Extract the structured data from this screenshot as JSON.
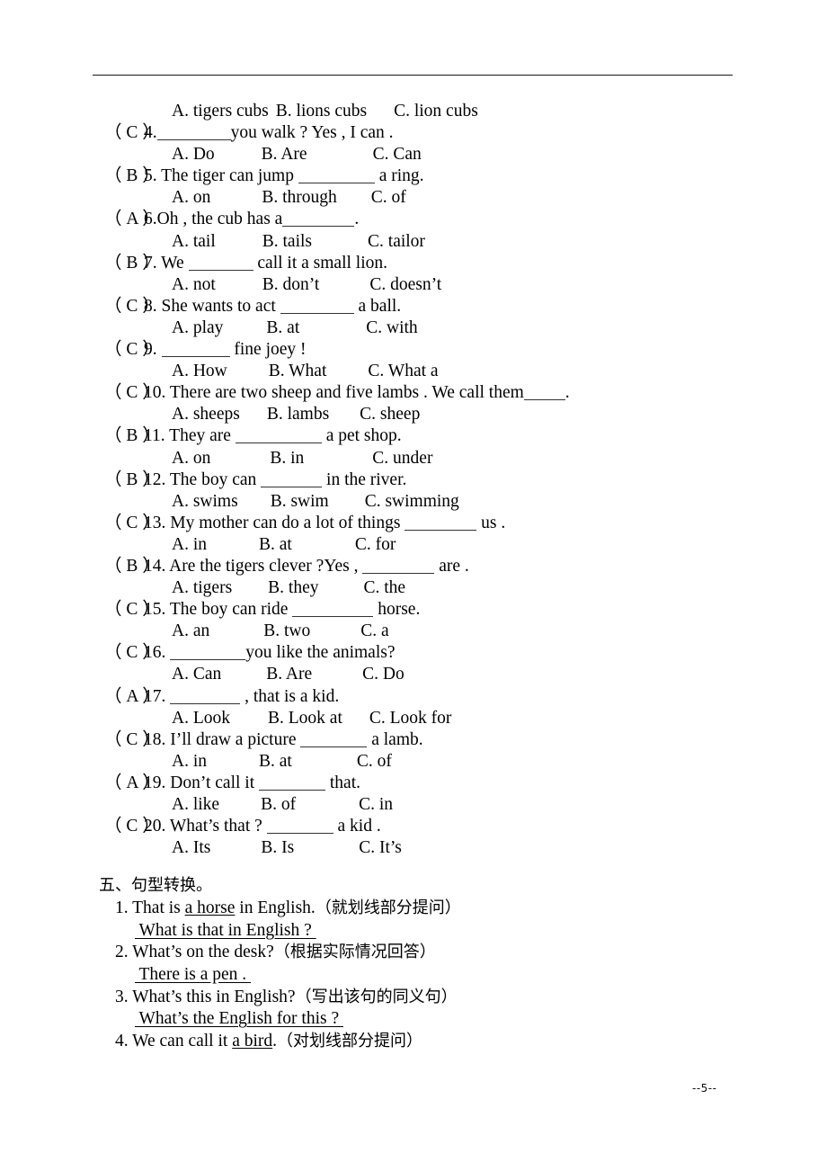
{
  "page": {
    "footer_label": "--5--",
    "header_rule": true
  },
  "orphan_options": {
    "a": "A. tigers cubs",
    "b": "B. lions cubs",
    "c": "C. lion cubs"
  },
  "multiple_choice": {
    "questions": [
      {
        "answer": "C",
        "number": "4.",
        "text_before": "",
        "blank_width": 82,
        "text_after": "you walk ? Yes , I can .",
        "options": [
          {
            "label": "A. Do",
            "gap": 52
          },
          {
            "label": "B. Are",
            "gap": 73
          },
          {
            "label": "C. Can",
            "gap": 0
          }
        ]
      },
      {
        "answer": "B",
        "number": "5.",
        "text_before": " The tiger can jump ",
        "blank_width": 85,
        "text_after": " a ring.",
        "options": [
          {
            "label": "A. on",
            "gap": 57
          },
          {
            "label": "B. through",
            "gap": 38
          },
          {
            "label": "C. of",
            "gap": 0
          }
        ]
      },
      {
        "answer": "A",
        "number": "6.",
        "text_before": "Oh , the cub has a",
        "blank_width": 80,
        "text_after": ".",
        "options": [
          {
            "label": "A. tail",
            "gap": 52
          },
          {
            "label": "B. tails",
            "gap": 62
          },
          {
            "label": "C. tailor",
            "gap": 0
          }
        ]
      },
      {
        "answer": "B",
        "number": "7.",
        "text_before": " We ",
        "blank_width": 72,
        "text_after": " call it a small lion.",
        "options": [
          {
            "label": "A. not",
            "gap": 52
          },
          {
            "label": "B. don’t",
            "gap": 56
          },
          {
            "label": "C. doesn’t",
            "gap": 0
          }
        ]
      },
      {
        "answer": "C",
        "number": "8.",
        "text_before": " She wants to act ",
        "blank_width": 82,
        "text_after": " a ball.",
        "options": [
          {
            "label": "A. play",
            "gap": 48
          },
          {
            "label": "B. at",
            "gap": 74
          },
          {
            "label": "C. with",
            "gap": 0
          }
        ]
      },
      {
        "answer": "C",
        "number": "9.",
        "text_before": " ",
        "blank_width": 76,
        "text_after": " fine joey !",
        "options": [
          {
            "label": "A. How",
            "gap": 46
          },
          {
            "label": "B. What",
            "gap": 46
          },
          {
            "label": "C. What a",
            "gap": 0
          }
        ]
      },
      {
        "answer": "C",
        "number": "10.",
        "text_before": " There are two sheep and five lambs . We call them",
        "blank_width": 46,
        "text_after": ".",
        "options": [
          {
            "label": "A. sheeps",
            "gap": 30
          },
          {
            "label": "B. lambs",
            "gap": 34
          },
          {
            "label": "C. sheep",
            "gap": 0
          }
        ]
      },
      {
        "answer": "B",
        "number": "11.",
        "text_before": " They are ",
        "blank_width": 96,
        "text_after": " a pet shop.",
        "options": [
          {
            "label": "A. on",
            "gap": 66
          },
          {
            "label": "B. in",
            "gap": 76
          },
          {
            "label": "C. under",
            "gap": 0
          }
        ]
      },
      {
        "answer": "B",
        "number": "12.",
        "text_before": " The boy can ",
        "blank_width": 68,
        "text_after": " in the river.",
        "options": [
          {
            "label": "A. swims",
            "gap": 36
          },
          {
            "label": "B. swim",
            "gap": 40
          },
          {
            "label": "C. swimming",
            "gap": 0
          }
        ]
      },
      {
        "answer": "C",
        "number": "13.",
        "text_before": " My mother can do a lot of things ",
        "blank_width": 80,
        "text_after": " us .",
        "options": [
          {
            "label": "A. in",
            "gap": 58
          },
          {
            "label": "B. at",
            "gap": 70
          },
          {
            "label": "C. for",
            "gap": 0
          }
        ]
      },
      {
        "answer": "B",
        "number": "14.",
        "text_before": " Are the tigers clever ?Yes , ",
        "blank_width": 80,
        "text_after": " are .",
        "options": [
          {
            "label": "A. tigers",
            "gap": 40
          },
          {
            "label": "B. they",
            "gap": 50
          },
          {
            "label": "C. the",
            "gap": 0
          }
        ]
      },
      {
        "answer": "C",
        "number": "15.",
        "text_before": " The boy can ride ",
        "blank_width": 90,
        "text_after": " horse.",
        "options": [
          {
            "label": "A. an",
            "gap": 60
          },
          {
            "label": "B. two",
            "gap": 56
          },
          {
            "label": "C. a",
            "gap": 0
          }
        ]
      },
      {
        "answer": "C",
        "number": "16.",
        "text_before": " ",
        "blank_width": 84,
        "text_after": "you like the animals?",
        "options": [
          {
            "label": "A. Can",
            "gap": 50
          },
          {
            "label": "B. Are",
            "gap": 56
          },
          {
            "label": "C. Do",
            "gap": 0
          }
        ]
      },
      {
        "answer": "A",
        "number": "17.",
        "text_before": " ",
        "blank_width": 78,
        "text_after": " , that is a kid.",
        "options": [
          {
            "label": "A. Look",
            "gap": 42
          },
          {
            "label": "B. Look at",
            "gap": 30
          },
          {
            "label": "C. Look for",
            "gap": 0
          }
        ]
      },
      {
        "answer": "C",
        "number": "18.",
        "text_before": " I’ll draw a picture ",
        "blank_width": 74,
        "text_after": " a lamb.",
        "options": [
          {
            "label": "A. in",
            "gap": 58
          },
          {
            "label": "B. at",
            "gap": 72
          },
          {
            "label": "C. of",
            "gap": 0
          }
        ]
      },
      {
        "answer": "A",
        "number": "19.",
        "text_before": " Don’t call it ",
        "blank_width": 74,
        "text_after": " that.",
        "options": [
          {
            "label": "A. like",
            "gap": 46
          },
          {
            "label": "B. of",
            "gap": 70
          },
          {
            "label": "C. in",
            "gap": 0
          }
        ]
      },
      {
        "answer": "C",
        "number": "20.",
        "text_before": " What’s that ? ",
        "blank_width": 74,
        "text_after": " a kid .",
        "options": [
          {
            "label": "A. Its",
            "gap": 56
          },
          {
            "label": "B. Is",
            "gap": 72
          },
          {
            "label": "C. It’s",
            "gap": 0
          }
        ]
      }
    ]
  },
  "section_five": {
    "heading": "五、句型转换。",
    "items": [
      {
        "number": "1.",
        "pre": " That is ",
        "underlined": "a horse",
        "post": " in English.",
        "instruction": "（就划线部分提问）",
        "answer": " What is that in English ? "
      },
      {
        "number": "2.",
        "pre": " What’s on the desk?",
        "underlined": "",
        "post": "",
        "instruction": "（根据实际情况回答）",
        "answer": " There is a pen . "
      },
      {
        "number": "3.",
        "pre": " What’s this in English?",
        "underlined": "",
        "post": "",
        "instruction": "（写出该句的同义句）",
        "answer": " What’s the English for this ? "
      },
      {
        "number": "4.",
        "pre": " We can call it ",
        "underlined": "a bird",
        "post": ".",
        "instruction": "（对划线部分提问）",
        "answer": ""
      }
    ]
  }
}
